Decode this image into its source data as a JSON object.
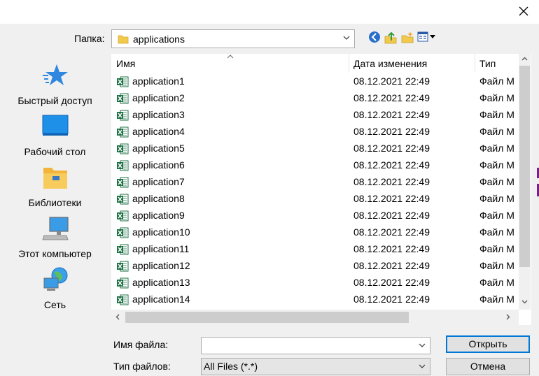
{
  "dialog": {
    "close_glyph": "✕"
  },
  "location": {
    "label": "Папка:",
    "value": "applications"
  },
  "toolbar": {
    "icons": [
      "back-icon",
      "up-folder-icon",
      "new-folder-icon",
      "view-menu-icon"
    ]
  },
  "places": [
    {
      "label": "Быстрый доступ",
      "icon": "star-icon"
    },
    {
      "label": "Рабочий стол",
      "icon": "desktop-icon"
    },
    {
      "label": "Библиотеки",
      "icon": "libraries-icon"
    },
    {
      "label": "Этот компьютер",
      "icon": "computer-icon"
    },
    {
      "label": "Сеть",
      "icon": "network-icon"
    }
  ],
  "columns": {
    "name": "Имя",
    "date": "Дата изменения",
    "type": "Тип"
  },
  "files": [
    {
      "name": "application1",
      "date": "08.12.2021 22:49",
      "type": "Файл M"
    },
    {
      "name": "application2",
      "date": "08.12.2021 22:49",
      "type": "Файл M"
    },
    {
      "name": "application3",
      "date": "08.12.2021 22:49",
      "type": "Файл M"
    },
    {
      "name": "application4",
      "date": "08.12.2021 22:49",
      "type": "Файл M"
    },
    {
      "name": "application5",
      "date": "08.12.2021 22:49",
      "type": "Файл M"
    },
    {
      "name": "application6",
      "date": "08.12.2021 22:49",
      "type": "Файл M"
    },
    {
      "name": "application7",
      "date": "08.12.2021 22:49",
      "type": "Файл M"
    },
    {
      "name": "application8",
      "date": "08.12.2021 22:49",
      "type": "Файл M"
    },
    {
      "name": "application9",
      "date": "08.12.2021 22:49",
      "type": "Файл M"
    },
    {
      "name": "application10",
      "date": "08.12.2021 22:49",
      "type": "Файл M"
    },
    {
      "name": "application11",
      "date": "08.12.2021 22:49",
      "type": "Файл M"
    },
    {
      "name": "application12",
      "date": "08.12.2021 22:49",
      "type": "Файл M"
    },
    {
      "name": "application13",
      "date": "08.12.2021 22:49",
      "type": "Файл M"
    },
    {
      "name": "application14",
      "date": "08.12.2021 22:49",
      "type": "Файл M"
    }
  ],
  "file_name": {
    "label": "Имя файла:",
    "value": ""
  },
  "file_type": {
    "label": "Тип файлов:",
    "value": "All Files (*.*)"
  },
  "buttons": {
    "open": "Открыть",
    "cancel": "Отмена"
  },
  "colors": {
    "accent": "#0078d7",
    "excel_green": "#1e7145"
  }
}
